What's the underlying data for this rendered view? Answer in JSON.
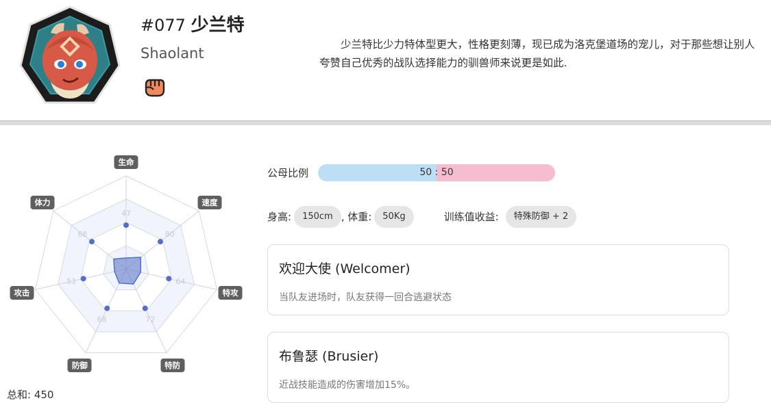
{
  "pokemon": {
    "number": "#077",
    "name_cn": "少兰特",
    "name_en": "Shaolant",
    "type_icon": "fist-icon",
    "description": "少兰特比少力特体型更大，性格更刻薄，现已成为洛克堡道场的宠儿，对于那些想让别人夸赞自己优秀的战队选择能力的驯兽师来说更是如此."
  },
  "stats": {
    "labels": [
      "生命",
      "速度",
      "特攻",
      "特防",
      "防御",
      "攻击",
      "体力"
    ],
    "values": [
      47,
      80,
      64,
      72,
      68,
      51,
      68
    ],
    "total_text": "总和: 450"
  },
  "gender": {
    "label": "公母比例",
    "male": 50,
    "female": 50,
    "text": "50 : 50",
    "male_color": "#bcdff6",
    "female_color": "#f6bcd0"
  },
  "body_info": {
    "height_label": "身高:",
    "height_value": "150cm",
    "weight_label": ", 体重:",
    "weight_value": "50Kg",
    "training_label": "训练值收益:",
    "training_value": "特殊防御 + 2"
  },
  "abilities": [
    {
      "name": "欢迎大使 (Welcomer)",
      "effect": "当队友进场时，队友获得一回合逃避状态"
    },
    {
      "name": "布鲁瑟 (Brusier)",
      "effect": "近战技能造成的伤害增加15%。"
    }
  ]
}
